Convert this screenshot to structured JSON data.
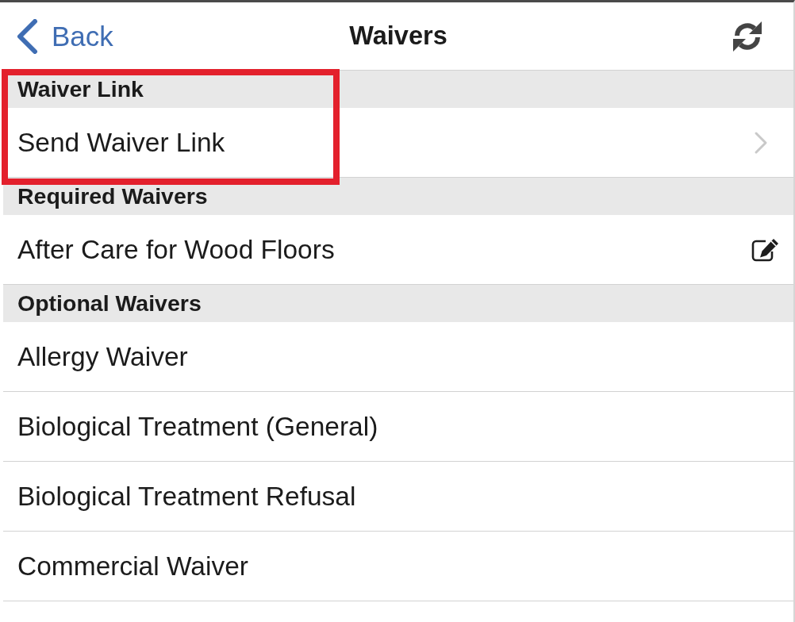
{
  "nav_bar": {
    "back_label": "Back",
    "title": "Waivers"
  },
  "sections": [
    {
      "header": "Waiver Link",
      "highlighted": true,
      "rows": [
        {
          "label": "Send Waiver Link",
          "kind": "link"
        }
      ]
    },
    {
      "header": "Required Waivers",
      "highlighted": false,
      "rows": [
        {
          "label": "After Care for Wood Floors",
          "kind": "edit"
        }
      ]
    },
    {
      "header": "Optional Waivers",
      "highlighted": false,
      "rows": [
        {
          "label": "Allergy Waiver",
          "kind": "plain"
        },
        {
          "label": "Biological Treatment (General)",
          "kind": "plain"
        },
        {
          "label": "Biological Treatment Refusal",
          "kind": "plain"
        },
        {
          "label": "Commercial Waiver",
          "kind": "plain"
        }
      ]
    }
  ]
}
